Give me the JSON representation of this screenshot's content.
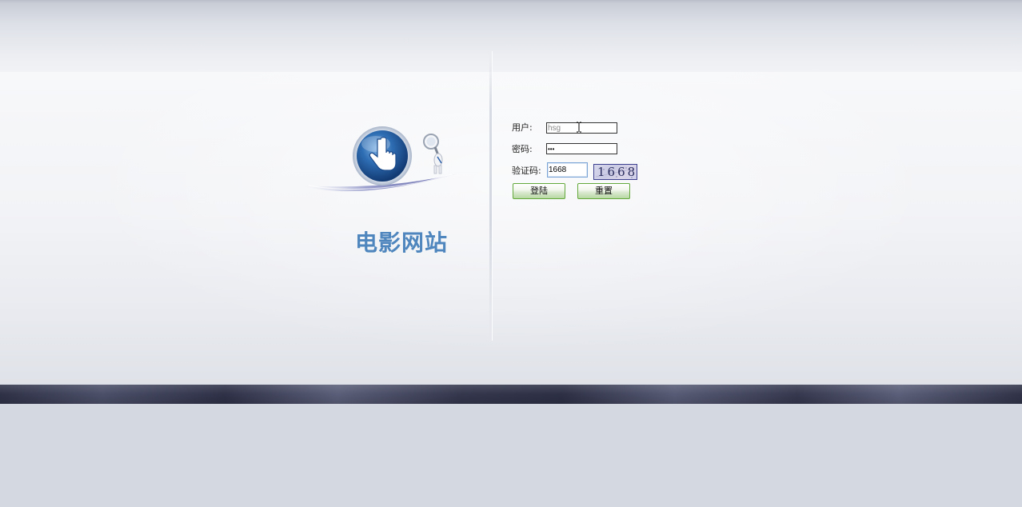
{
  "site": {
    "title": "电影网站"
  },
  "login_form": {
    "username_label": "用户:",
    "username_value": "hsg",
    "password_label": "密码:",
    "password_value": "•••",
    "captcha_label": "验证码:",
    "captcha_value": "1668",
    "captcha_image_text": "1668",
    "login_button": "登陆",
    "reset_button": "重置"
  },
  "colors": {
    "title": "#4f86bd",
    "dark_band": "#2f3247",
    "button_border": "#62a83b",
    "captcha_border": "#3d3f8f",
    "background": "#d3d8e1"
  },
  "icons": {
    "logo": "pointing-hand-globe-icon",
    "mascot": "magnifier-figure-icon",
    "cursor": "text-ibeam-cursor-icon"
  }
}
